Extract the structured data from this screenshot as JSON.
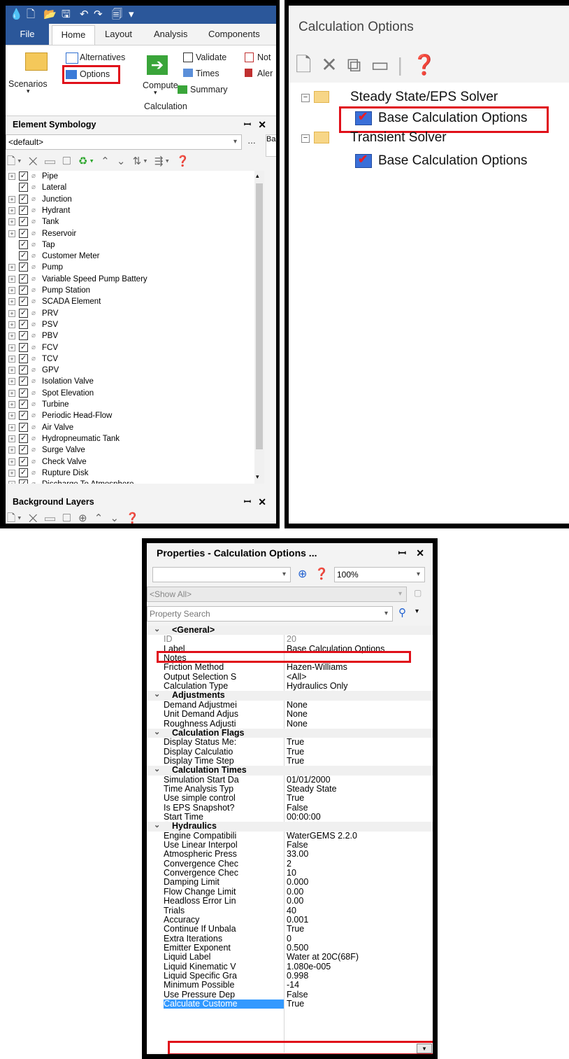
{
  "app": {
    "tabs": [
      "File",
      "Home",
      "Layout",
      "Analysis",
      "Components"
    ],
    "ribbon": {
      "scenarios_label": "Scenarios",
      "alternatives_label": "Alternatives",
      "options_label": "Options",
      "compute_label": "Compute",
      "validate_label": "Validate",
      "times_label": "Times",
      "summary_label": "Summary",
      "notes_label": "Not",
      "alerts_label": "Aler",
      "group_label": "Calculation"
    },
    "element_symbology": {
      "title": "Element Symbology",
      "combo_value": "<default>",
      "items": [
        "Pipe",
        "Lateral",
        "Junction",
        "Hydrant",
        "Tank",
        "Reservoir",
        "Tap",
        "Customer Meter",
        "Pump",
        "Variable Speed Pump Battery",
        "Pump Station",
        "SCADA Element",
        "PRV",
        "PSV",
        "PBV",
        "FCV",
        "TCV",
        "GPV",
        "Isolation Valve",
        "Spot Elevation",
        "Turbine",
        "Periodic Head-Flow",
        "Air Valve",
        "Hydropneumatic Tank",
        "Surge Valve",
        "Check Valve",
        "Rupture Disk",
        "Discharge To Atmosphere"
      ]
    },
    "background_layers": {
      "title": "Background Layers"
    },
    "side_tab": "Ba"
  },
  "calc_options": {
    "title": "Calculation Options",
    "tree": {
      "steady_label": "Steady State/EPS Solver",
      "steady_child": "Base Calculation Options",
      "transient_label": "Transient Solver",
      "transient_child": "Base Calculation Options"
    }
  },
  "properties": {
    "title": "Properties - Calculation Options ...",
    "zoom": "100%",
    "show_all": "<Show All>",
    "search_placeholder": "Property Search",
    "categories": [
      {
        "name": "<General>",
        "rows": [
          {
            "k": "ID",
            "v": "20",
            "ro": true
          },
          {
            "k": "Label",
            "v": "Base Calculation Options"
          },
          {
            "k": "Notes",
            "v": ""
          },
          {
            "k": "Friction Method",
            "v": "Hazen-Williams"
          },
          {
            "k": "Output Selection S",
            "v": "<All>"
          },
          {
            "k": "Calculation Type",
            "v": "Hydraulics Only"
          }
        ]
      },
      {
        "name": "Adjustments",
        "rows": [
          {
            "k": "Demand Adjustmei",
            "v": "None"
          },
          {
            "k": "Unit Demand Adjus",
            "v": "None"
          },
          {
            "k": "Roughness Adjusti",
            "v": "None"
          }
        ]
      },
      {
        "name": "Calculation Flags",
        "rows": [
          {
            "k": "Display Status Me:",
            "v": "True"
          },
          {
            "k": "Display Calculatio",
            "v": "True"
          },
          {
            "k": "Display Time Step",
            "v": "True"
          }
        ]
      },
      {
        "name": "Calculation Times",
        "rows": [
          {
            "k": "Simulation Start Da",
            "v": "01/01/2000"
          },
          {
            "k": "Time Analysis Typ",
            "v": "Steady State"
          },
          {
            "k": "Use simple control",
            "v": "True"
          },
          {
            "k": "Is EPS Snapshot?",
            "v": "False"
          },
          {
            "k": "Start Time",
            "v": "00:00:00"
          }
        ]
      },
      {
        "name": "Hydraulics",
        "rows": [
          {
            "k": "Engine Compatibili",
            "v": "WaterGEMS 2.2.0"
          },
          {
            "k": "Use Linear Interpol",
            "v": "False"
          },
          {
            "k": "Atmospheric Press",
            "v": "33.00"
          },
          {
            "k": "Convergence Chec",
            "v": "2"
          },
          {
            "k": "Convergence Chec",
            "v": "10"
          },
          {
            "k": "Damping Limit",
            "v": "0.000"
          },
          {
            "k": "Flow Change Limit",
            "v": "0.00"
          },
          {
            "k": "Headloss Error Lin",
            "v": "0.00"
          },
          {
            "k": "Trials",
            "v": "40"
          },
          {
            "k": "Accuracy",
            "v": "0.001"
          },
          {
            "k": "Continue If Unbala",
            "v": "True"
          },
          {
            "k": "Extra Iterations",
            "v": "0"
          },
          {
            "k": "Emitter Exponent",
            "v": "0.500"
          },
          {
            "k": "Liquid Label",
            "v": "Water at 20C(68F)"
          },
          {
            "k": "Liquid Kinematic V",
            "v": "1.080e-005"
          },
          {
            "k": "Liquid Specific Gra",
            "v": "0.998"
          },
          {
            "k": "Minimum Possible",
            "v": "-14"
          },
          {
            "k": "Use Pressure Dep",
            "v": "False"
          },
          {
            "k": "Calculate Custome",
            "v": "True",
            "selected": true
          }
        ]
      }
    ]
  }
}
